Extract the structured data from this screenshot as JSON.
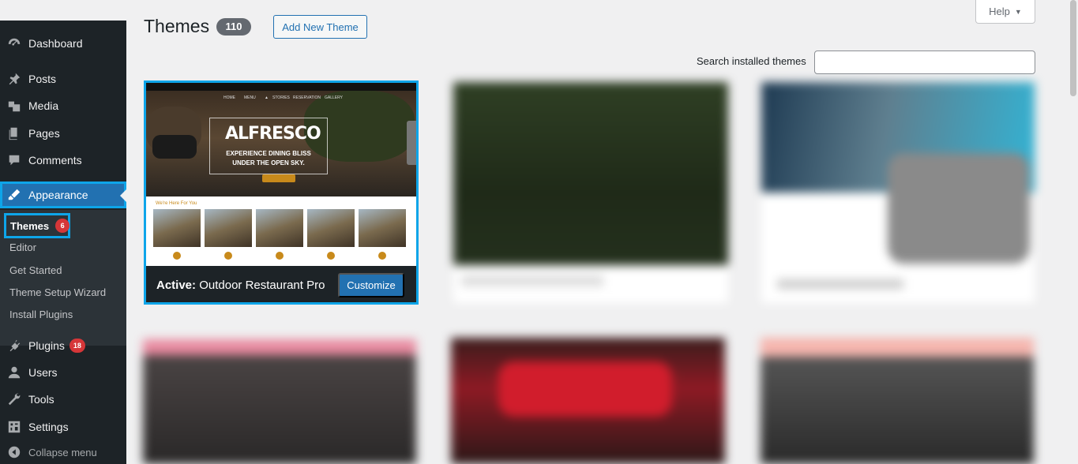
{
  "sidebar": {
    "items": [
      {
        "label": "Dashboard",
        "icon": "dashboard-icon"
      },
      {
        "label": "Posts",
        "icon": "pin-icon"
      },
      {
        "label": "Media",
        "icon": "media-icon"
      },
      {
        "label": "Pages",
        "icon": "pages-icon"
      },
      {
        "label": "Comments",
        "icon": "comment-icon"
      },
      {
        "label": "Appearance",
        "icon": "brush-icon"
      },
      {
        "label": "Plugins",
        "icon": "plugin-icon",
        "badge": "18"
      },
      {
        "label": "Users",
        "icon": "user-icon"
      },
      {
        "label": "Tools",
        "icon": "wrench-icon"
      },
      {
        "label": "Settings",
        "icon": "settings-icon"
      },
      {
        "label": "Collapse menu",
        "icon": "collapse-icon"
      }
    ],
    "submenu": {
      "themes": {
        "label": "Themes",
        "badge": "6"
      },
      "items": [
        "Editor",
        "Get Started",
        "Theme Setup Wizard",
        "Install Plugins"
      ]
    }
  },
  "header": {
    "title": "Themes",
    "count": "110",
    "add_new": "Add New Theme",
    "help": "Help",
    "search_label": "Search installed themes",
    "search_value": ""
  },
  "active_theme": {
    "active_label": "Active:",
    "name": "Outdoor Restaurant Pro",
    "customize": "Customize",
    "screenshot": {
      "hero_title": "ALFRESCO",
      "hero_sub": "EXPERIENCE DINING BLISS UNDER THE OPEN SKY.",
      "section_title": "We're Here For You"
    }
  },
  "colors": {
    "sidebar_bg": "#1d2327",
    "accent": "#2271b1",
    "highlight_outline": "#0ea5e9",
    "badge": "#d63638"
  }
}
